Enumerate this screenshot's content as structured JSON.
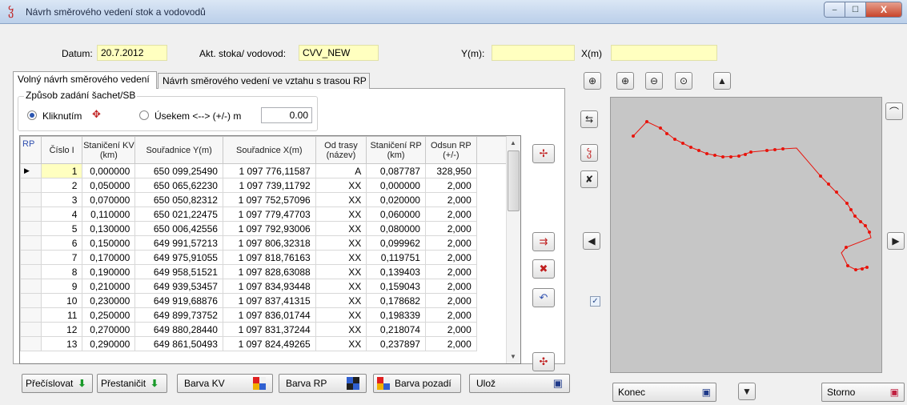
{
  "window": {
    "title": "Návrh směrového vedení stok a vodovodů",
    "min": "–",
    "max": "☐",
    "close": "X"
  },
  "header": {
    "datum_label": "Datum:",
    "datum_value": "20.7.2012",
    "akt_label": "Akt. stoka/ vodovod:",
    "akt_value": "CVV_NEW",
    "y_label": "Y(m):",
    "y_value": "",
    "x_label": "X(m)",
    "x_value": ""
  },
  "tabs": [
    "Volný návrh směrového vedení",
    "Návrh směrového vedení ve vztahu s trasou RP"
  ],
  "group": {
    "title": "Způsob zadání šachet/SB",
    "option1": "Kliknutím",
    "option2": "Úsekem <--> (+/-) m",
    "step_value": "0.00"
  },
  "table": {
    "columns": [
      "RP",
      "Číslo I",
      "Staničení KV (km)",
      "Souřadnice Y(m)",
      "Souřadnice X(m)",
      "Od trasy (název)",
      "Staničení RP (km)",
      "Odsun RP (+/-)"
    ],
    "rows": [
      [
        "1",
        "0,000000",
        "650 099,25490",
        "1 097 776,11587",
        "A",
        "0,087787",
        "328,950"
      ],
      [
        "2",
        "0,050000",
        "650 065,62230",
        "1 097 739,11792",
        "XX",
        "0,000000",
        "2,000"
      ],
      [
        "3",
        "0,070000",
        "650 050,82312",
        "1 097 752,57096",
        "XX",
        "0,020000",
        "2,000"
      ],
      [
        "4",
        "0,110000",
        "650 021,22475",
        "1 097 779,47703",
        "XX",
        "0,060000",
        "2,000"
      ],
      [
        "5",
        "0,130000",
        "650 006,42556",
        "1 097 792,93006",
        "XX",
        "0,080000",
        "2,000"
      ],
      [
        "6",
        "0,150000",
        "649 991,57213",
        "1 097 806,32318",
        "XX",
        "0,099962",
        "2,000"
      ],
      [
        "7",
        "0,170000",
        "649 975,91055",
        "1 097 818,76163",
        "XX",
        "0,119751",
        "2,000"
      ],
      [
        "8",
        "0,190000",
        "649 958,51521",
        "1 097 828,63088",
        "XX",
        "0,139403",
        "2,000"
      ],
      [
        "9",
        "0,210000",
        "649 939,53457",
        "1 097 834,93448",
        "XX",
        "0,159043",
        "2,000"
      ],
      [
        "10",
        "0,230000",
        "649 919,68876",
        "1 097 837,41315",
        "XX",
        "0,178682",
        "2,000"
      ],
      [
        "11",
        "0,250000",
        "649 899,73752",
        "1 097 836,01744",
        "XX",
        "0,198339",
        "2,000"
      ],
      [
        "12",
        "0,270000",
        "649 880,28440",
        "1 097 831,37244",
        "XX",
        "0,218074",
        "2,000"
      ],
      [
        "13",
        "0,290000",
        "649 861,50493",
        "1 097 824,49265",
        "XX",
        "0,237897",
        "2,000"
      ]
    ]
  },
  "buttons": {
    "precislovat": "Přečíslovat",
    "prestanicit": "Přestaničit",
    "barva_kv": "Barva KV",
    "barva_rp": "Barva RP",
    "barva_pozadi": "Barva pozadí",
    "uloz": "Ulož",
    "konec": "Konec",
    "storno": "Storno"
  },
  "colors": {
    "field_bg": "#ffffc0",
    "route": "#e8140c",
    "canvas_bg": "#c6c6c6"
  }
}
